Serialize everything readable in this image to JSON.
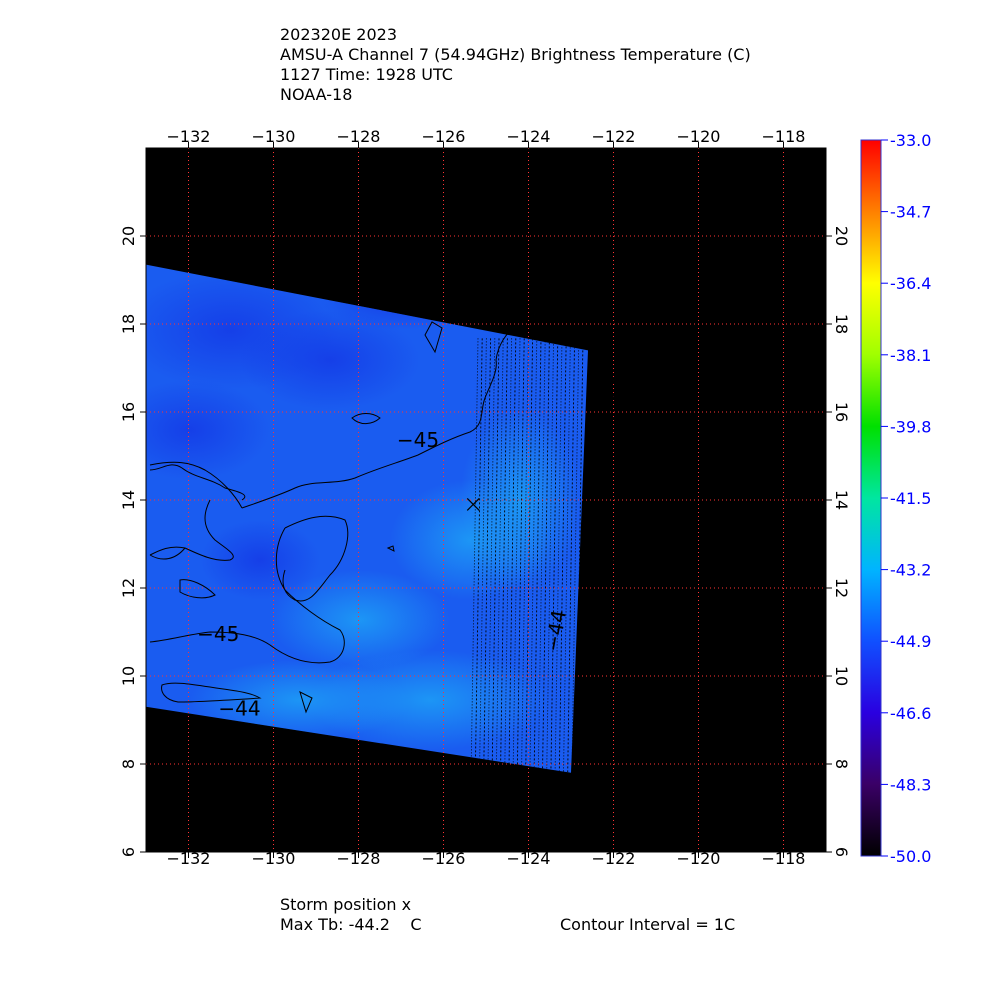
{
  "header": {
    "line1": "202320E 2023",
    "line2": "AMSU-A Channel 7 (54.94GHz) Brightness Temperature (C)",
    "line3": "1127 Time: 1928 UTC",
    "line4": "NOAA-18"
  },
  "footer": {
    "storm_position": "Storm position x",
    "max_tb": "Max Tb: -44.2    C",
    "contour_interval": "Contour Interval = 1C"
  },
  "chart_data": {
    "type": "heatmap",
    "xlim": [
      -133.0,
      -117.0
    ],
    "ylim": [
      6.0,
      22.0
    ],
    "x_ticks": [
      -132,
      -130,
      -128,
      -126,
      -124,
      -122,
      -120,
      -118
    ],
    "x_tick_labels": [
      "−132",
      "−130",
      "−128",
      "−126",
      "−124",
      "−122",
      "−120",
      "−118"
    ],
    "y_ticks": [
      6,
      8,
      10,
      12,
      14,
      16,
      18,
      20
    ],
    "y_tick_labels": [
      "6",
      "8",
      "10",
      "12",
      "14",
      "16",
      "18",
      "20"
    ],
    "grid": true,
    "grid_color": "#ff3333",
    "background_color": "#000000",
    "field_color": "#1a5cf0",
    "swath_corners": [
      [
        -133.0,
        19.35
      ],
      [
        -122.6,
        17.4
      ],
      [
        -123.0,
        7.8
      ],
      [
        -133.0,
        9.3
      ]
    ],
    "storm_position": {
      "lon": -125.3,
      "lat": 13.9,
      "marker": "x"
    },
    "contour_labels": [
      {
        "text": "−45",
        "lon": -126.6,
        "lat": 15.2
      },
      {
        "text": "−45",
        "lon": -131.3,
        "lat": 10.8
      },
      {
        "text": "−44",
        "lon": -123.2,
        "lat": 11.0
      },
      {
        "text": "−44",
        "lon": -130.8,
        "lat": 9.1
      }
    ],
    "colorbar": {
      "min": -50.0,
      "max": -33.0,
      "tick_values": [
        -33.0,
        -34.7,
        -36.4,
        -38.1,
        -39.8,
        -41.5,
        -43.2,
        -44.9,
        -46.6,
        -48.3,
        -50.0
      ],
      "tick_labels": [
        "-33.0",
        "-34.7",
        "-36.4",
        "-38.1",
        "-39.8",
        "-41.5",
        "-43.2",
        "-44.9",
        "-46.6",
        "-48.3",
        "-50.0"
      ],
      "label_color": "#0000ff",
      "stops": [
        {
          "value": -50.0,
          "color": "#000000"
        },
        {
          "value": -48.3,
          "color": "#3a0066"
        },
        {
          "value": -46.6,
          "color": "#2a00e0"
        },
        {
          "value": -44.9,
          "color": "#1050ff"
        },
        {
          "value": -43.2,
          "color": "#00b4ff"
        },
        {
          "value": -41.5,
          "color": "#00e6a0"
        },
        {
          "value": -39.8,
          "color": "#00e000"
        },
        {
          "value": -38.1,
          "color": "#a0ff00"
        },
        {
          "value": -36.4,
          "color": "#ffff00"
        },
        {
          "value": -34.7,
          "color": "#ff8000"
        },
        {
          "value": -33.0,
          "color": "#ff0000"
        }
      ]
    }
  }
}
